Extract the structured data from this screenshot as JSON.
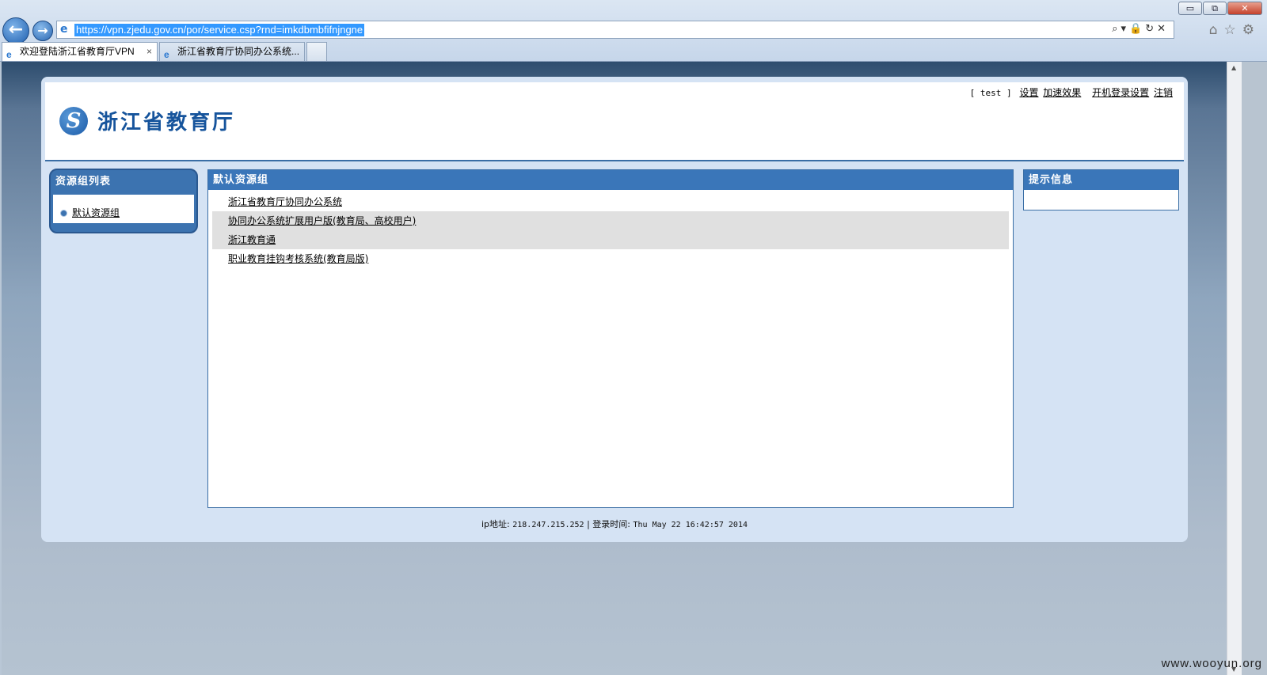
{
  "browser": {
    "url": "https://vpn.zjedu.gov.cn/por/service.csp?rnd=imkdbmbfifnjngne",
    "tabs": [
      {
        "label": "欢迎登陆浙江省教育厅VPN",
        "close": "×"
      },
      {
        "label": "浙江省教育厅协同办公系统..."
      }
    ],
    "window_buttons": {
      "minimize": "▭",
      "restore": "⧉",
      "close": "✕"
    },
    "nav": {
      "back": "←",
      "forward": "→"
    },
    "addr_tools": "⌕▾🔒↻✕",
    "toolbar_icons": "⌂☆⚙"
  },
  "header": {
    "logo_text": "浙江省教育厅",
    "user": "[ test ]",
    "links": {
      "settings": "设置",
      "speedup": "加速效果",
      "startup_login": "开机登录设置",
      "logout": "注销"
    }
  },
  "sidebar": {
    "title": "资源组列表",
    "items": [
      {
        "label": "默认资源组"
      }
    ]
  },
  "main": {
    "title": "默认资源组",
    "resources": [
      {
        "label": "浙江省教育厅协同办公系统"
      },
      {
        "label": "协同办公系统扩展用户版(教育局、高校用户)"
      },
      {
        "label": "浙江教育通"
      },
      {
        "label": "职业教育挂钩考核系统(教育局版)"
      }
    ]
  },
  "info": {
    "title": "提示信息"
  },
  "footer": {
    "ip_label": "ip地址:",
    "ip": "218.247.215.252",
    "separator": "|",
    "login_label": "登录时间:",
    "login_time": "Thu May 22 16:42:57 2014"
  },
  "watermark": "www.wooyun.org",
  "colors": {
    "accent": "#3a76b9",
    "panel_bg": "#d5e3f4",
    "logo": "#16549c"
  }
}
